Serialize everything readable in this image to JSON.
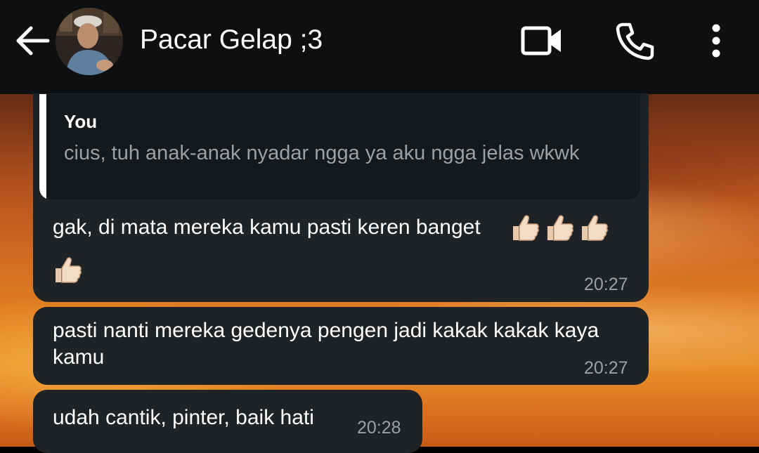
{
  "header": {
    "contact_name": "Pacar Gelap ;3",
    "back_icon": "arrow-left-icon",
    "video_icon": "video-call-icon",
    "call_icon": "phone-icon",
    "menu_icon": "more-vertical-icon"
  },
  "messages": [
    {
      "reply": {
        "sender": "You",
        "text": "cius, tuh anak-anak nyadar ngga ya aku ngga jelas wkwk"
      },
      "text": "gak, di mata mereka kamu pasti keren banget",
      "emoji": [
        "thumbs-up",
        "thumbs-up",
        "thumbs-up",
        "thumbs-up"
      ],
      "time": "20:27"
    },
    {
      "text": "pasti nanti mereka gedenya pengen jadi kakak kakak kaya kamu",
      "time": "20:27"
    },
    {
      "text": "udah cantik, pinter, baik hati",
      "time": "20:28"
    }
  ],
  "colors": {
    "topbar": "#0e0f10",
    "bubble": "#1f2326",
    "quote_bg": "#16191b",
    "quote_text": "#9aa0a4",
    "time_text": "#9aa0a4"
  }
}
